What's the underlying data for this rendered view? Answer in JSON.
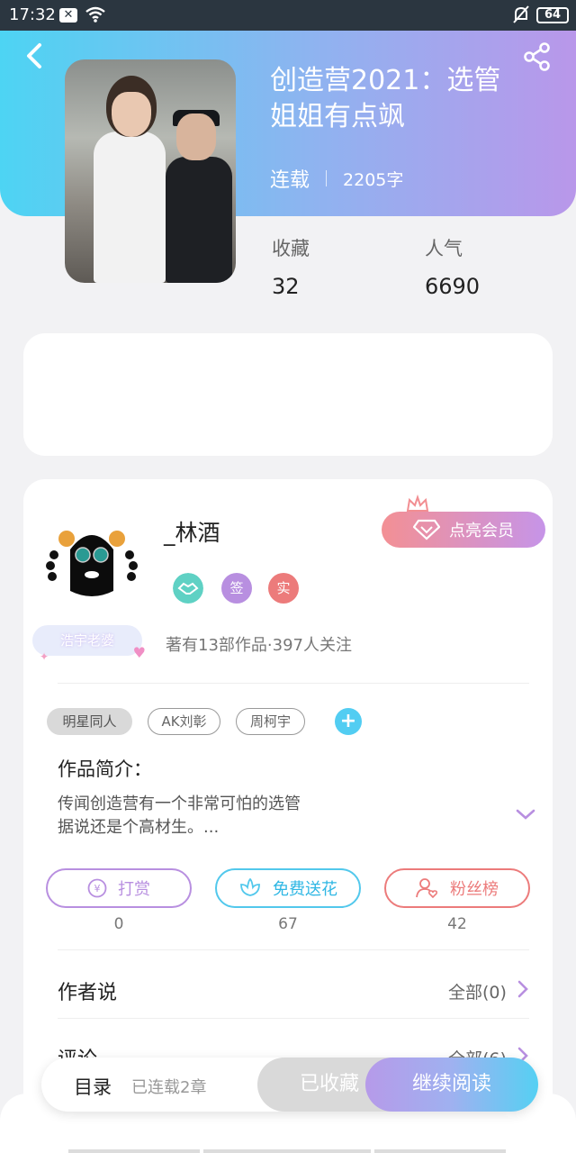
{
  "status_bar": {
    "time": "17:32",
    "battery": "64"
  },
  "book": {
    "title": "创造营2021：选管姐姐有点飒",
    "status": "连载",
    "word_count": "2205字",
    "favorites_label": "收藏",
    "favorites": "32",
    "popularity_label": "人气",
    "popularity": "6690"
  },
  "author": {
    "name": "_林酒",
    "badges": [
      "签",
      "实"
    ],
    "fan_tag": "浩宇老婆",
    "stats": "著有13部作品·397人关注",
    "vip_button": "点亮会员"
  },
  "tags": [
    "明星同人",
    "AK刘彰",
    "周柯宇"
  ],
  "intro": {
    "title": "作品简介：",
    "text_line1": "传闻创造营有一个非常可怕的选管",
    "text_line2": "据说还是个高材生。..."
  },
  "actions": [
    {
      "label": "打赏",
      "count": "0",
      "color": "#b88fe0"
    },
    {
      "label": "免费送花",
      "count": "67",
      "color": "#52c8ec"
    },
    {
      "label": "粉丝榜",
      "count": "42",
      "color": "#ec7b7b"
    }
  ],
  "author_says": {
    "title": "作者说",
    "more": "全部(0)"
  },
  "comments": {
    "title": "评论",
    "more": "全部(6)"
  },
  "bottom": {
    "toc": "目录",
    "chapters": "已连载2章",
    "favorited": "已收藏",
    "continue_reading": "继续阅读"
  },
  "colors": {
    "header_start": "#4dd4f3",
    "header_end": "#b997ea",
    "accent_purple": "#b88fe0"
  }
}
